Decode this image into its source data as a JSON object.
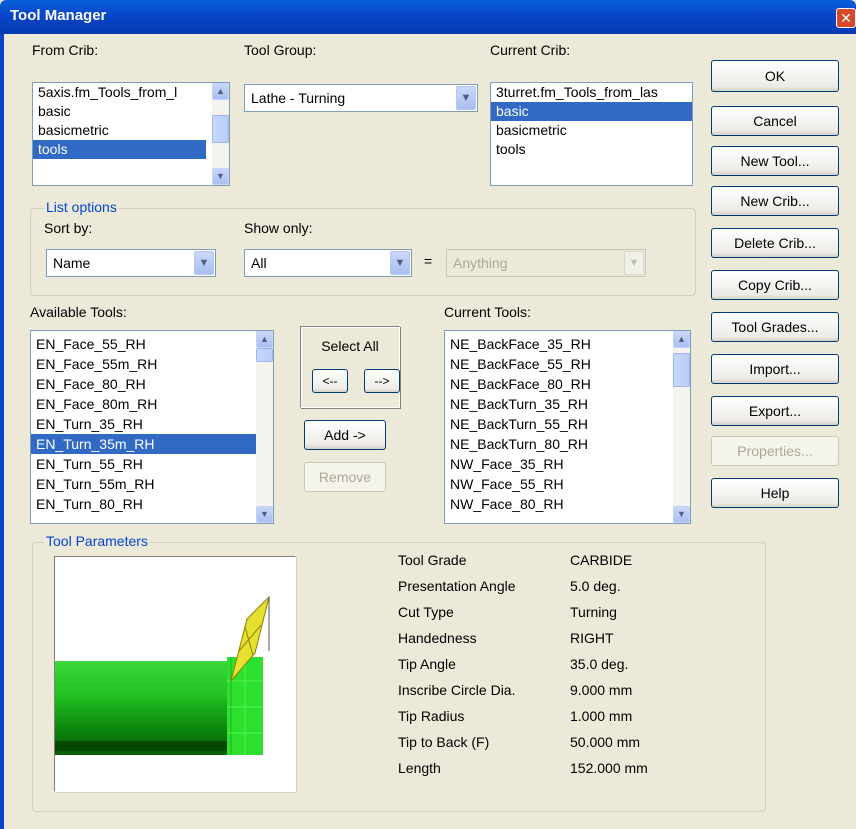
{
  "window": {
    "title": "Tool Manager"
  },
  "from_crib": {
    "label": "From Crib:",
    "items": [
      "5axis.fm_Tools_from_l",
      "basic",
      "basicmetric",
      "tools"
    ],
    "selected_index": 3
  },
  "tool_group": {
    "label": "Tool Group:",
    "value": "Lathe - Turning"
  },
  "current_crib": {
    "label": "Current Crib:",
    "items": [
      "3turret.fm_Tools_from_las",
      "basic",
      "basicmetric",
      "tools"
    ],
    "selected_index": 1
  },
  "list_options": {
    "legend": "List options",
    "sort_by": {
      "label": "Sort by:",
      "value": "Name"
    },
    "show_only": {
      "label": "Show only:",
      "value": "All"
    },
    "equals": "=",
    "anything": {
      "value": "Anything"
    }
  },
  "available_tools": {
    "label": "Available Tools:",
    "items": [
      "EN_Face_55_RH",
      "EN_Face_55m_RH",
      "EN_Face_80_RH",
      "EN_Face_80m_RH",
      "EN_Turn_35_RH",
      "EN_Turn_35m_RH",
      "EN_Turn_55_RH",
      "EN_Turn_55m_RH",
      "EN_Turn_80_RH"
    ],
    "selected_index": 5
  },
  "select_all": {
    "label": "Select All",
    "left": "<--",
    "right": "-->"
  },
  "add_label": "Add ->",
  "remove_label": "Remove",
  "current_tools": {
    "label": "Current Tools:",
    "items": [
      "NE_BackFace_35_RH",
      "NE_BackFace_55_RH",
      "NE_BackFace_80_RH",
      "NE_BackTurn_35_RH",
      "NE_BackTurn_55_RH",
      "NE_BackTurn_80_RH",
      "NW_Face_35_RH",
      "NW_Face_55_RH",
      "NW_Face_80_RH"
    ]
  },
  "buttons": {
    "ok": "OK",
    "cancel": "Cancel",
    "new_tool": "New Tool...",
    "new_crib": "New Crib...",
    "delete_crib": "Delete Crib...",
    "copy_crib": "Copy Crib...",
    "tool_grades": "Tool Grades...",
    "import": "Import...",
    "export": "Export...",
    "properties": "Properties...",
    "help": "Help"
  },
  "tool_parameters": {
    "legend": "Tool Parameters",
    "rows": [
      {
        "name": "Tool Grade",
        "value": "CARBIDE"
      },
      {
        "name": "Presentation Angle",
        "value": "5.0 deg."
      },
      {
        "name": "Cut Type",
        "value": "Turning"
      },
      {
        "name": "Handedness",
        "value": "RIGHT"
      },
      {
        "name": "Tip Angle",
        "value": "35.0 deg."
      },
      {
        "name": "Inscribe Circle Dia.",
        "value": "9.000 mm"
      },
      {
        "name": "Tip Radius",
        "value": "1.000 mm"
      },
      {
        "name": "Tip to Back (F)",
        "value": "50.000 mm"
      },
      {
        "name": "Length",
        "value": "152.000 mm"
      }
    ]
  },
  "colors": {
    "selection": "#316ac5",
    "title_bar": "#0846c8",
    "group_legend": "#0046d5",
    "stock_green": "#22cc22",
    "insert_yellow": "#e8e030"
  }
}
